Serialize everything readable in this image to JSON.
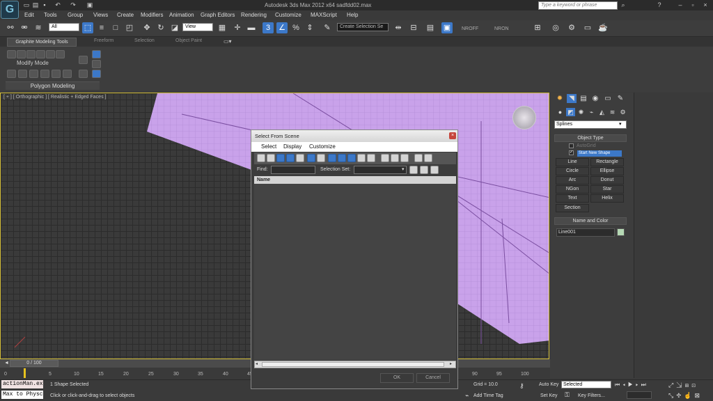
{
  "app": {
    "title": "Autodesk 3ds Max  2012 x64     sadfdd02.max",
    "search_placeholder": "Type a keyword or phrase"
  },
  "menu": [
    "Edit",
    "Tools",
    "Group",
    "Views",
    "Create",
    "Modifiers",
    "Animation",
    "Graph Editors",
    "Rendering",
    "Customize",
    "MAXScript",
    "Help"
  ],
  "toolbar": {
    "selection_filter": "All",
    "ref_coord": "View",
    "named_selection": "Create Selection Se",
    "nroff": "NROFF",
    "nron": "NRON"
  },
  "ribbon": {
    "tabs": [
      "Graphite Modeling Tools",
      "Freeform",
      "Selection",
      "Object Paint"
    ],
    "modify_mode": "Modify Mode",
    "panel": "Polygon Modeling"
  },
  "viewport": {
    "label": "[ + ] [ Orthographic ] [ Realistic + Edged Faces ]"
  },
  "command_panel": {
    "category": "Splines",
    "object_type_header": "Object Type",
    "autogrid": "AutoGrid",
    "start_new_shape": "Start New Shape",
    "buttons": [
      "Line",
      "Rectangle",
      "Circle",
      "Ellipse",
      "Arc",
      "Donut",
      "NGon",
      "Star",
      "Text",
      "Helix",
      "Section"
    ],
    "name_color_header": "Name and Color",
    "object_name": "Line001",
    "object_color": "#b5d8b4"
  },
  "timeline": {
    "position": "0 / 100",
    "ticks": [
      "0",
      "5",
      "10",
      "15",
      "20",
      "25",
      "30",
      "35",
      "40",
      "45",
      "90",
      "95",
      "100"
    ]
  },
  "status": {
    "maxscript_1": "actionMan.ex",
    "maxscript_2": "Max to Physc",
    "selected": "1 Shape Selected",
    "prompt": "Click or click-and-drag to select objects",
    "grid": "Grid = 10.0",
    "add_time_tag": "Add Time Tag",
    "auto_key": "Auto Key",
    "set_key": "Set Key",
    "key_mode": "Selected",
    "key_filters": "Key Filters..."
  },
  "dialog": {
    "title": "Select From Scene",
    "menu": [
      "Select",
      "Display",
      "Customize"
    ],
    "find_label": "Find:",
    "find_value": "",
    "selection_set_label": "Selection Set:",
    "column_name": "Name",
    "ok": "OK",
    "cancel": "Cancel"
  },
  "colors": {
    "accent": "#3c78c8",
    "viewport_border": "#d8c23a",
    "shape_fill": "#c8a0e8"
  }
}
